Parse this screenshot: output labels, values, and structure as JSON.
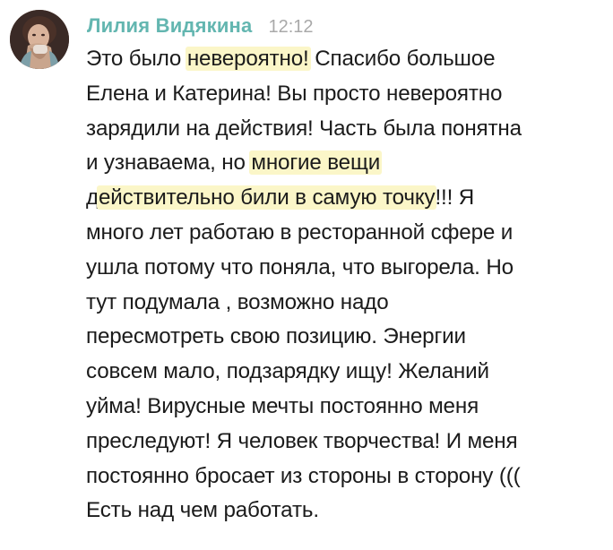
{
  "message": {
    "author": "Лилия Видякина",
    "time": "12:12",
    "lines": [
      {
        "before": "Это было ",
        "highlight": "невероятно!",
        "after": " Спасибо большое"
      },
      {
        "before": "Елена и Катерина! Вы просто невероятно",
        "highlight": "",
        "after": ""
      },
      {
        "before": "зарядили на действия! Часть была понятна",
        "highlight": "",
        "after": ""
      },
      {
        "before": "и узнаваема, но ",
        "highlight": "многие вещи",
        "after": ""
      },
      {
        "before": "д",
        "highlight": "ействительно били в самую точку",
        "after": "!!! Я"
      },
      {
        "before": "много лет работаю в ресторанной сфере и",
        "highlight": "",
        "after": ""
      },
      {
        "before": "ушла потому что поняла, что выгорела. Но",
        "highlight": "",
        "after": ""
      },
      {
        "before": "тут подумала , возможно надо",
        "highlight": "",
        "after": ""
      },
      {
        "before": "пересмотреть свою позицию. Энергии",
        "highlight": "",
        "after": ""
      },
      {
        "before": "совсем мало, подзарядку ищу! Желаний",
        "highlight": "",
        "after": ""
      },
      {
        "before": "уйма! Вирусные мечты постоянно меня",
        "highlight": "",
        "after": ""
      },
      {
        "before": "преследуют! Я человек творчества! И меня",
        "highlight": "",
        "after": ""
      },
      {
        "before": "постоянно бросает из стороны в сторону (((",
        "highlight": "",
        "after": ""
      },
      {
        "before": "Есть над чем работать.",
        "highlight": "",
        "after": ""
      }
    ]
  },
  "colors": {
    "author": "#63b6b0",
    "time": "#a9a9a9",
    "text": "#1b1b1b",
    "highlight": "#fbf6c8"
  }
}
